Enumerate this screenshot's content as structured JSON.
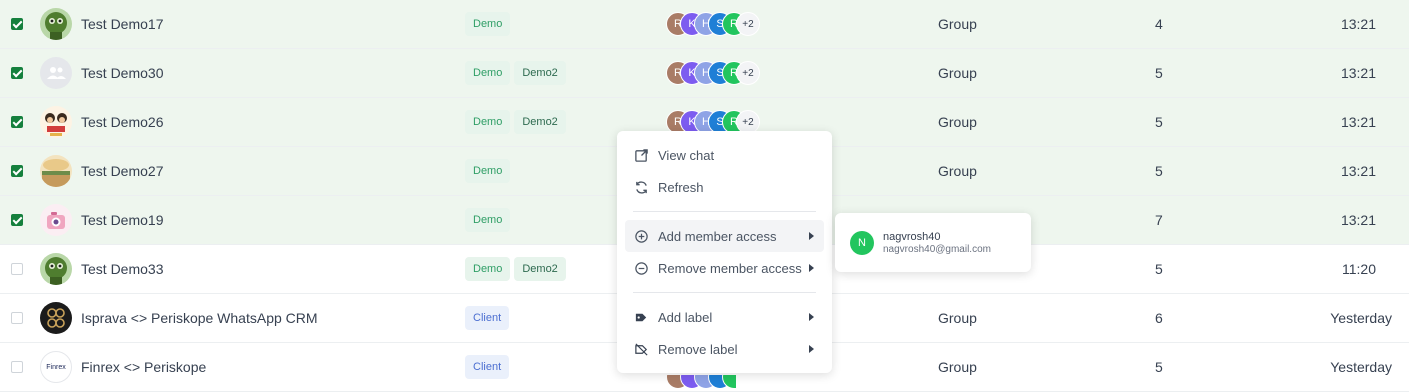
{
  "rows": [
    {
      "name": "Test Demo17",
      "selected": true,
      "avatar_icon": "green-robot-avatar-icon",
      "labels": [
        {
          "text": "Demo",
          "kind": "demo"
        }
      ],
      "members": [
        "R",
        "K",
        "H",
        "S",
        "R"
      ],
      "extra": "+2",
      "type": "Group",
      "count": "4",
      "time": "13:21"
    },
    {
      "name": "Test Demo30",
      "selected": true,
      "avatar_icon": "group-placeholder-icon",
      "labels": [
        {
          "text": "Demo",
          "kind": "demo"
        },
        {
          "text": "Demo2",
          "kind": "demo2"
        }
      ],
      "members": [
        "R",
        "K",
        "H",
        "S",
        "R"
      ],
      "extra": "+2",
      "type": "Group",
      "count": "5",
      "time": "13:21"
    },
    {
      "name": "Test Demo26",
      "selected": true,
      "avatar_icon": "cartoon-characters-avatar-icon",
      "labels": [
        {
          "text": "Demo",
          "kind": "demo"
        },
        {
          "text": "Demo2",
          "kind": "demo2"
        }
      ],
      "members": [
        "R",
        "K",
        "H",
        "S",
        "R"
      ],
      "extra": "+2",
      "type": "Group",
      "count": "5",
      "time": "13:21"
    },
    {
      "name": "Test Demo27",
      "selected": true,
      "avatar_icon": "landscape-avatar-icon",
      "labels": [
        {
          "text": "Demo",
          "kind": "demo"
        }
      ],
      "members": [],
      "extra": "",
      "type": "Group",
      "count": "5",
      "time": "13:21"
    },
    {
      "name": "Test Demo19",
      "selected": true,
      "avatar_icon": "camera-sticker-avatar-icon",
      "labels": [
        {
          "text": "Demo",
          "kind": "demo"
        }
      ],
      "members": [],
      "extra": "",
      "type": "",
      "count": "7",
      "time": "13:21"
    },
    {
      "name": "Test Demo33",
      "selected": false,
      "avatar_icon": "green-robot-avatar-icon",
      "labels": [
        {
          "text": "Demo",
          "kind": "demo"
        },
        {
          "text": "Demo2",
          "kind": "demo2"
        }
      ],
      "members": [],
      "extra": "",
      "type": "",
      "count": "5",
      "time": "11:20"
    },
    {
      "name": "Isprava <> Periskope WhatsApp CRM",
      "selected": false,
      "avatar_icon": "isprava-logo-icon",
      "labels": [
        {
          "text": "Client",
          "kind": "client"
        }
      ],
      "members": [],
      "extra": "",
      "type": "Group",
      "count": "6",
      "time": "Yesterday"
    },
    {
      "name": "Finrex <> Periskope",
      "selected": false,
      "avatar_icon": "finrex-logo-icon",
      "avatar_text": "Finrex",
      "labels": [
        {
          "text": "Client",
          "kind": "client"
        }
      ],
      "members": [],
      "extra": "",
      "type": "Group",
      "count": "5",
      "time": "Yesterday"
    }
  ],
  "member_colors": [
    "#a97c66",
    "#7c5cf0",
    "#8fa3e6",
    "#1f7fd6",
    "#22c55e"
  ],
  "context_menu": {
    "items": [
      {
        "label": "View chat",
        "icon": "external-link-icon",
        "has_submenu": false
      },
      {
        "label": "Refresh",
        "icon": "refresh-icon",
        "has_submenu": false
      },
      {
        "label": "Add member access",
        "icon": "plus-circle-icon",
        "has_submenu": true
      },
      {
        "label": "Remove member access",
        "icon": "minus-circle-icon",
        "has_submenu": true
      },
      {
        "label": "Add label",
        "icon": "tag-icon",
        "has_submenu": true
      },
      {
        "label": "Remove label",
        "icon": "tag-off-icon",
        "has_submenu": true
      }
    ]
  },
  "submenu": {
    "initial": "N",
    "name": "nagvrosh40",
    "email": "nagvrosh40@gmail.com"
  }
}
